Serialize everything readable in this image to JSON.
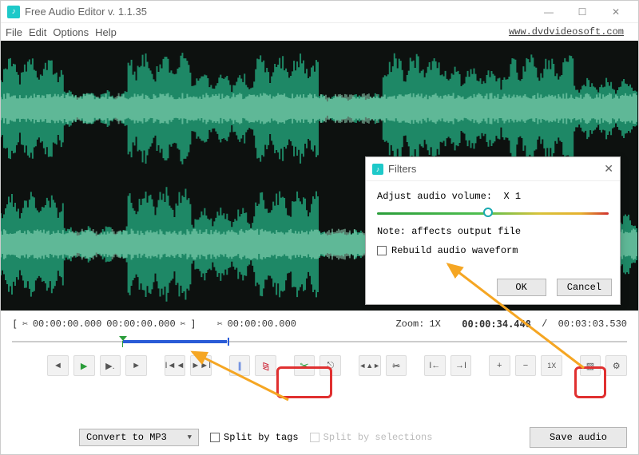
{
  "app": {
    "title": "Free Audio Editor v. 1.1.35",
    "url": "www.dvdvideosoft.com"
  },
  "menu": {
    "file": "File",
    "edit": "Edit",
    "options": "Options",
    "help": "Help"
  },
  "filters": {
    "title": "Filters",
    "volume_label": "Adjust audio volume:",
    "volume_value": "X 1",
    "note": "Note: affects output file",
    "rebuild": "Rebuild audio waveform",
    "ok": "OK",
    "cancel": "Cancel"
  },
  "info": {
    "sel_start": "00:00:00.000",
    "sel_end": "00:00:00.000",
    "cursor": "00:00:00.000",
    "zoom_label": "Zoom:",
    "zoom_value": "1X",
    "pos": "00:00:34.448",
    "dur": "00:03:03.530"
  },
  "bottom": {
    "convert": "Convert to MP3",
    "split_tags": "Split by tags",
    "split_sel": "Split by selections",
    "save": "Save audio"
  },
  "tb": {
    "onex": "1X"
  }
}
